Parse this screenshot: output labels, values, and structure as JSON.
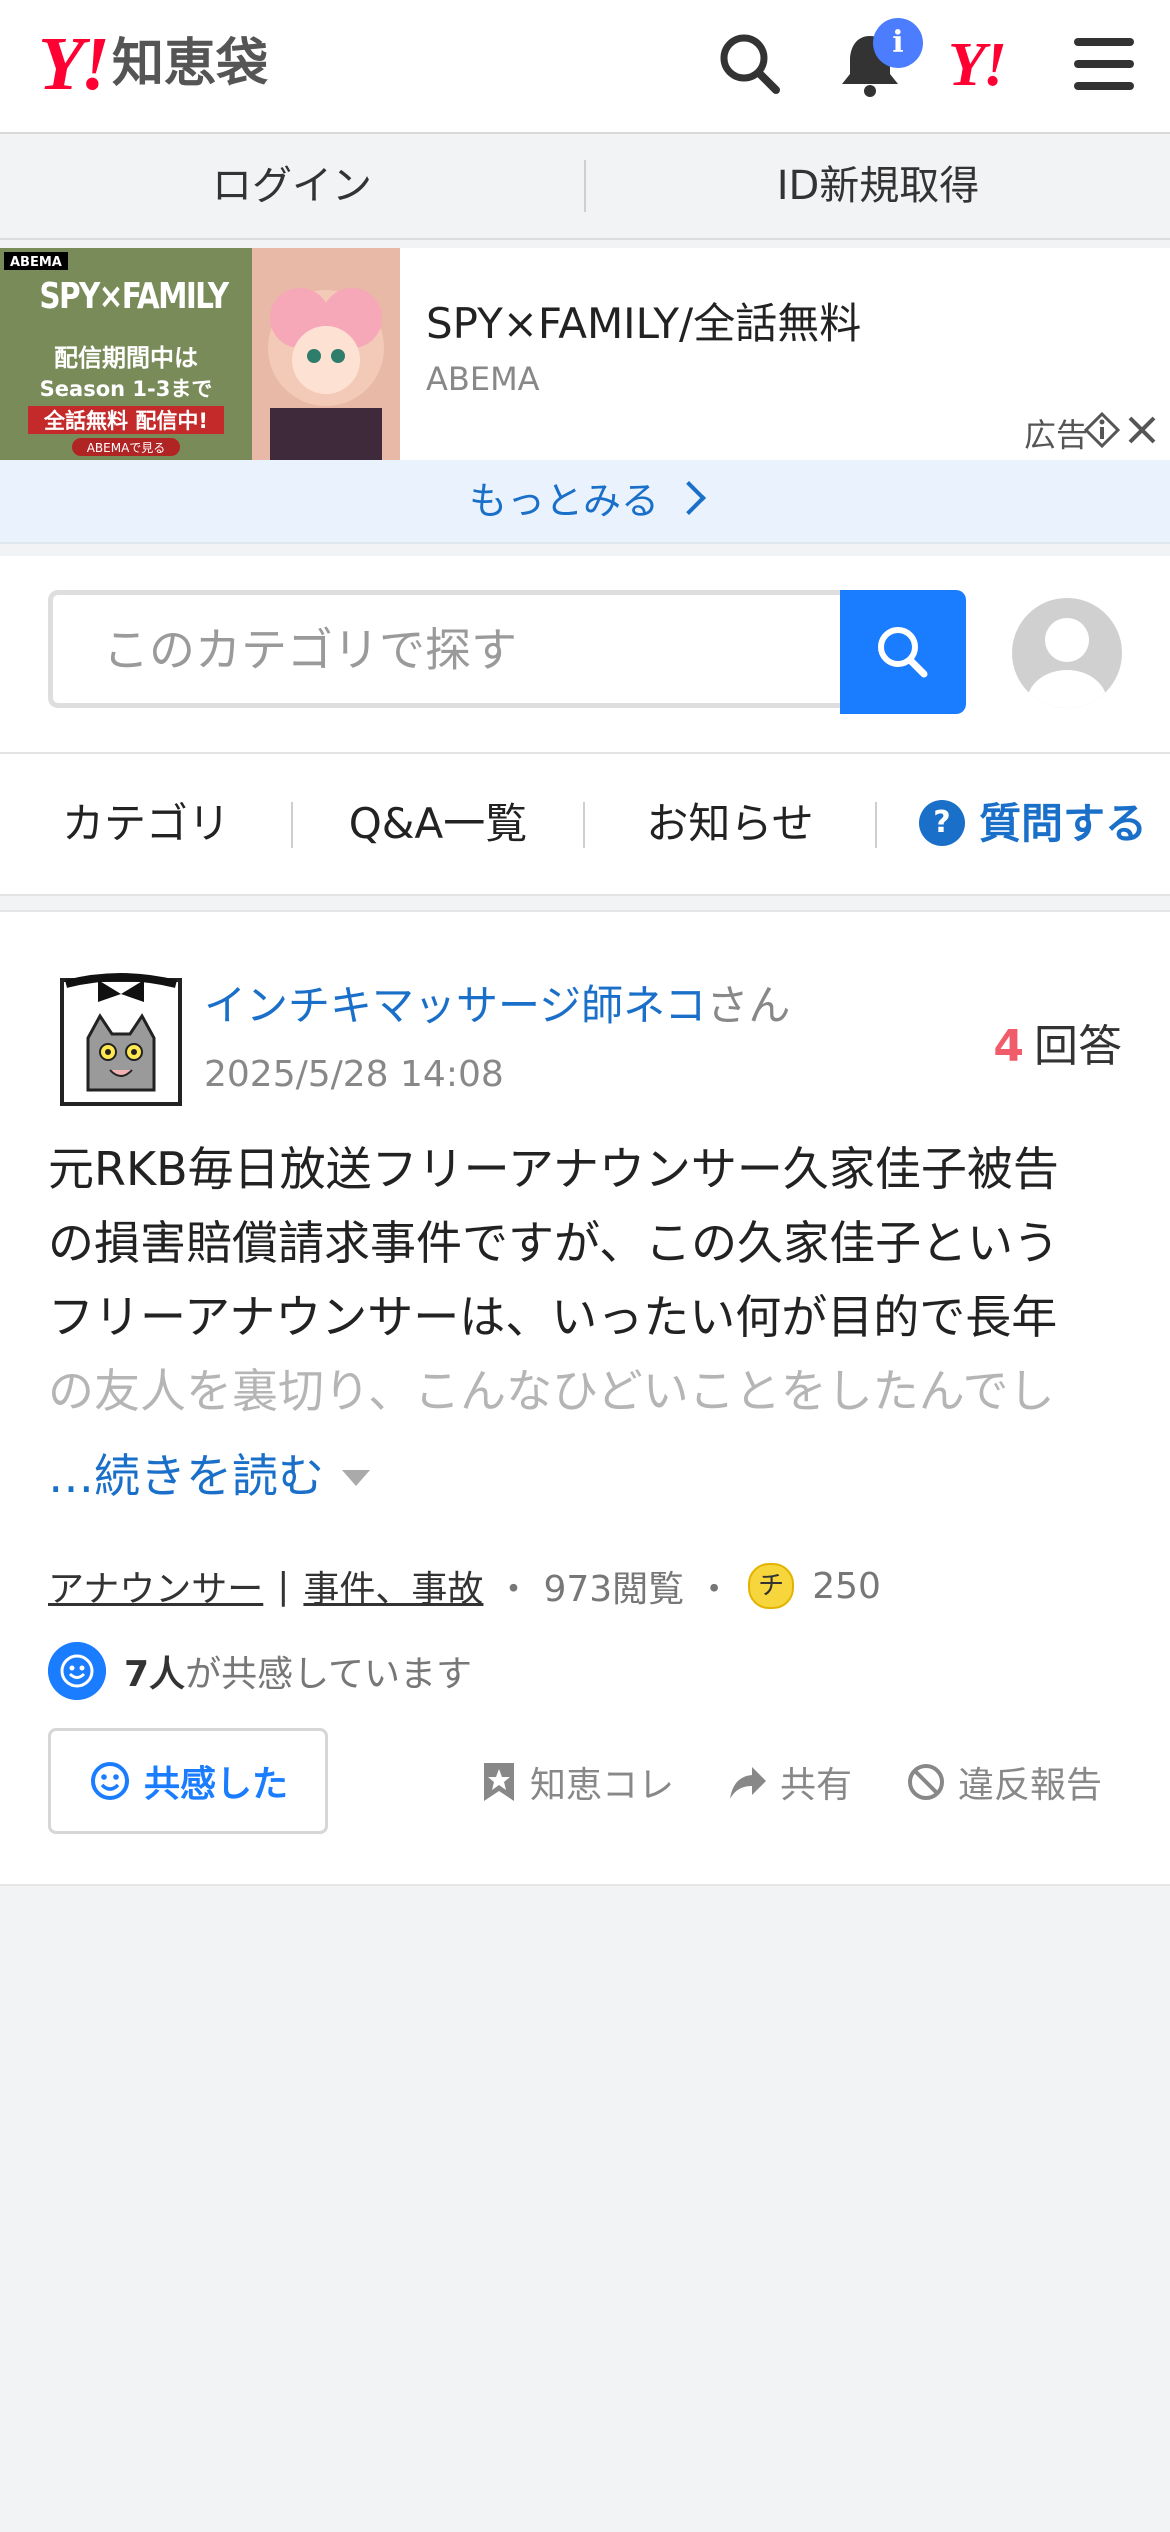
{
  "header": {
    "logo_y": "Y!",
    "logo_text": "知恵袋",
    "notification_badge": "i",
    "yahoo_mark": "Y!"
  },
  "auth": {
    "login": "ログイン",
    "signup": "ID新規取得"
  },
  "ad": {
    "title": "SPY×FAMILY/全話無料",
    "advertiser": "ABEMA",
    "label": "広告",
    "image_text": {
      "brand": "ABEMA",
      "logo": "SPY×FAMILY",
      "line1": "配信期間中は",
      "line2": "Season 1-3まで",
      "line3": "全話無料 配信中!",
      "cta": "ABEMAで見る"
    },
    "more": "もっとみる"
  },
  "search": {
    "placeholder": "このカテゴリで探す"
  },
  "tabs": {
    "category": "カテゴリ",
    "qa_list": "Q&A一覧",
    "news": "お知らせ",
    "ask": "質問する",
    "ask_icon": "?"
  },
  "question": {
    "user": "インチキマッサージ師ネコ",
    "honorific": "さん",
    "date": "2025/5/28 14:08",
    "answer_count": "4",
    "answer_label": "回答",
    "body_lines": [
      "元RKB毎日放送フリーアナウンサー久家佳子被告",
      "の損害賠償請求事件ですが、この久家佳子という",
      "フリーアナウンサーは、いったい何が目的で長年"
    ],
    "body_faded": "の友人を裏切り、こんなひどいことをしたんでし",
    "read_more": "…続きを読む",
    "category1": "アナウンサー",
    "sep": "|",
    "category2": "事件、事故",
    "views": "973閲覧",
    "coin_icon": "チ",
    "coins": "250",
    "empathy_count": "7人",
    "empathy_text": "が共感しています",
    "empathy_button": "共感した",
    "actions": {
      "save": "知恵コレ",
      "share": "共有",
      "report": "違反報告"
    }
  }
}
